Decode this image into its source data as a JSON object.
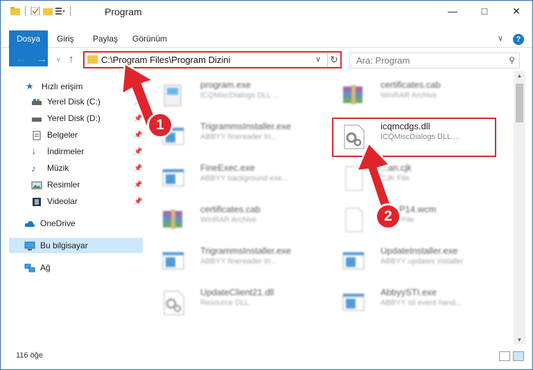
{
  "window": {
    "title": "Program"
  },
  "ribbon": {
    "tabs": [
      "Dosya",
      "Giriş",
      "Paylaş",
      "Görünüm"
    ]
  },
  "address": {
    "path": "C:\\Program Files\\Program Dizini"
  },
  "search": {
    "placeholder": "Ara: Program"
  },
  "sidebar": {
    "quick_access": "Hızlı erişim",
    "items": [
      {
        "label": "Yerel Disk (C:)",
        "icon": "drive-icon"
      },
      {
        "label": "Yerel Disk (D:)",
        "icon": "drive-icon"
      },
      {
        "label": "Belgeler",
        "icon": "documents-icon"
      },
      {
        "label": "İndirmeler",
        "icon": "download-icon"
      },
      {
        "label": "Müzik",
        "icon": "music-icon"
      },
      {
        "label": "Resimler",
        "icon": "pictures-icon"
      },
      {
        "label": "Videolar",
        "icon": "video-icon"
      }
    ],
    "onedrive": "OneDrive",
    "this_pc": "Bu bilgisayar",
    "network": "Ağ"
  },
  "files": [
    {
      "name": "program.exe",
      "desc": "ICQMiscDialogs DLL ...",
      "icon": "installer-icon"
    },
    {
      "name": "certificates.cab",
      "desc": "WinRAR Archive",
      "icon": "winrar-icon"
    },
    {
      "name": "TrigrammsInstaller.exe",
      "desc": "ABBYY finereader tri...",
      "icon": "app-icon"
    },
    {
      "name": "icqmcdgs.dll",
      "desc": "ICQMiscDialogs DLL ...",
      "icon": "dll-gear-icon"
    },
    {
      "name": "FineExec.exe",
      "desc": "ABBYY background exe...",
      "icon": "app-icon"
    },
    {
      "name": "...an.cjk",
      "desc": "CJK File",
      "icon": "blank-file-icon"
    },
    {
      "name": "certificates.cab",
      "desc": "WinRAR Archive",
      "icon": "winrar-icon"
    },
    {
      "name": "Sn...P14.wcm",
      "desc": "WCM File",
      "icon": "blank-file-icon"
    },
    {
      "name": "TrigrammsInstaller.exe",
      "desc": "ABBYY finereader tri...",
      "icon": "app-icon"
    },
    {
      "name": "UpdateInstaller.exe",
      "desc": "ABBYY updates installer",
      "icon": "app-icon"
    },
    {
      "name": "UpdateClient21.dll",
      "desc": "Resource DLL",
      "icon": "dll-gear-icon"
    },
    {
      "name": "AbbyySTI.exe",
      "desc": "ABBYY sti event hand...",
      "icon": "app-icon"
    }
  ],
  "status": {
    "count": "116 öğe"
  },
  "annotations": {
    "step1": "1",
    "step2": "2",
    "color": "#e0242c"
  }
}
